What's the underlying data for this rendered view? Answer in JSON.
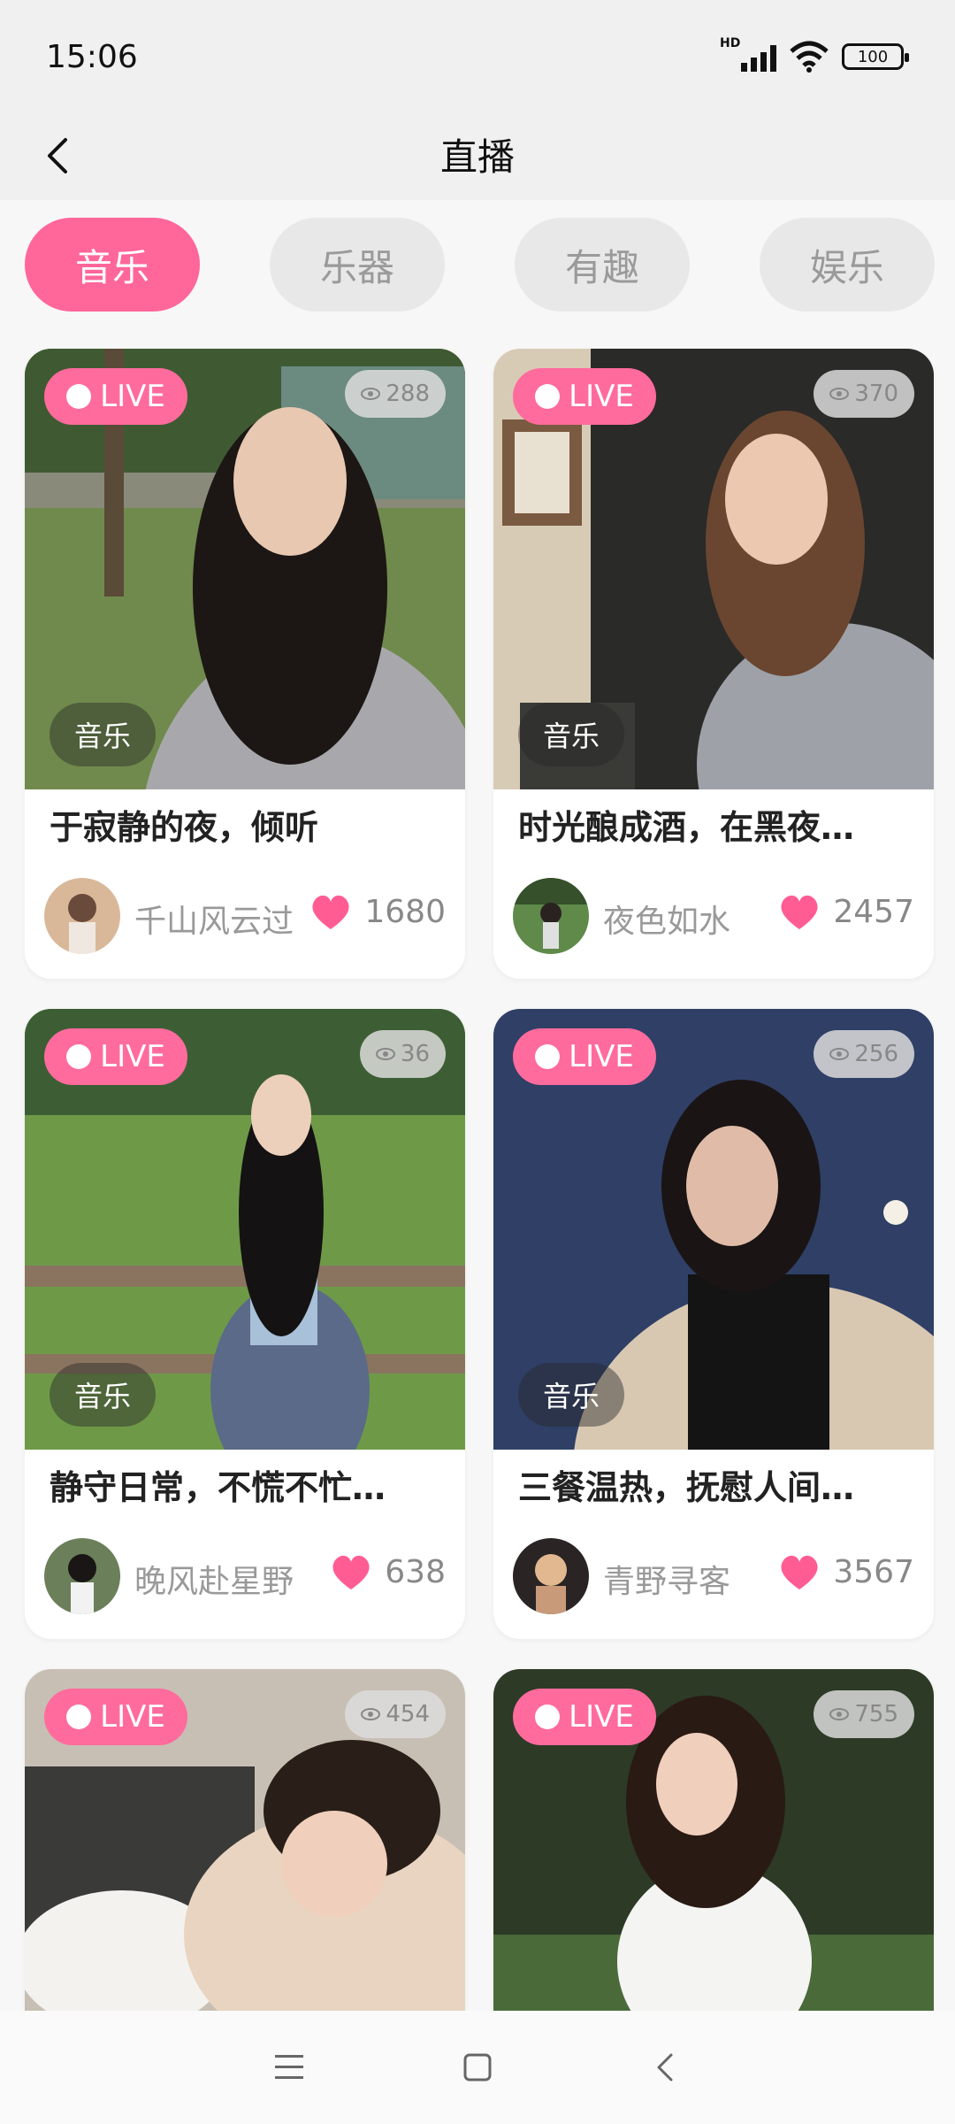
{
  "status": {
    "time": "15:06",
    "signal_label": "HD",
    "battery": "100"
  },
  "header": {
    "title": "直播"
  },
  "tabs": [
    {
      "label": "音乐",
      "active": true
    },
    {
      "label": "乐器",
      "active": false
    },
    {
      "label": "有趣",
      "active": false
    },
    {
      "label": "娱乐",
      "active": false
    }
  ],
  "live_label": "LIVE",
  "cards": [
    {
      "viewers": "288",
      "category": "音乐",
      "title": "于寂静的夜，倾听",
      "author": "千山风云过",
      "likes": "1680"
    },
    {
      "viewers": "370",
      "category": "音乐",
      "title": "时光酿成酒，在黑夜…",
      "author": "夜色如水",
      "likes": "2457"
    },
    {
      "viewers": "36",
      "category": "音乐",
      "title": "静守日常，不慌不忙…",
      "author": "晚风赴星野",
      "likes": "638"
    },
    {
      "viewers": "256",
      "category": "音乐",
      "title": "三餐温热，抚慰人间…",
      "author": "青野寻客",
      "likes": "3567"
    },
    {
      "viewers": "454"
    },
    {
      "viewers": "755"
    }
  ],
  "colors": {
    "accent": "#ff6699",
    "live_badge": "#ff6b9c",
    "heart": "#ff5c94"
  },
  "icons": {
    "back": "back-icon",
    "eye": "eye-icon",
    "heart": "heart-icon",
    "menu": "menu-icon",
    "home": "home-icon",
    "nav_back": "nav-back-icon"
  }
}
